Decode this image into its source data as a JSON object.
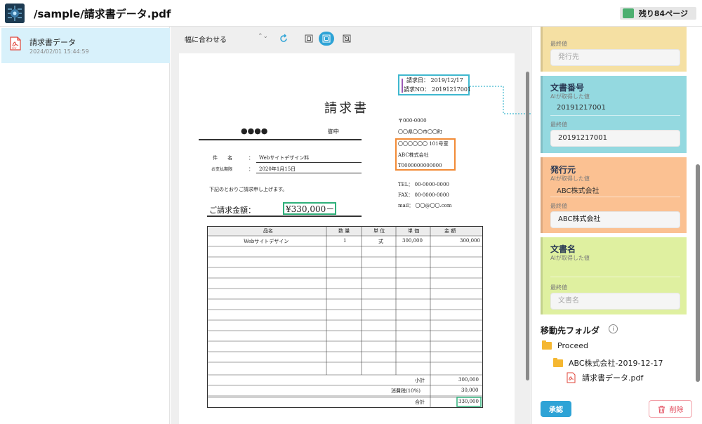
{
  "header": {
    "title": "/sample/請求書データ.pdf",
    "pages_badge": "残り84ページ",
    "badge_color": "#4caf70"
  },
  "file_list": {
    "items": [
      {
        "name": "請求書データ",
        "date": "2024/02/01 15:44:59",
        "icon": "pdf-file-icon"
      }
    ]
  },
  "viewer": {
    "fit_mode": "幅に合わせる",
    "tools": [
      "rotate-icon",
      "fit-page-icon",
      "fit-width-icon",
      "fit-none-icon"
    ]
  },
  "document": {
    "heading": "請求書",
    "invoice_date_label": "請求日：",
    "invoice_date": "2019/12/17",
    "invoice_no_label": "請求NO：",
    "invoice_no": "20191217001",
    "customer": "●●●●",
    "honorific": "御中",
    "subject_label": "件　　名",
    "subject_value": "Webサイトデザイン料",
    "due_label": "お支払期限",
    "due_value": "2020年1月15日",
    "colon": "：",
    "intro": "下記のとおりご請求申し上げます。",
    "amount_label": "ご請求金額：",
    "amount_value": "¥330,000－",
    "postal": "〒000-0000",
    "address1": "〇〇県〇〇市〇〇町",
    "address2": "〇〇〇〇〇〇 101号室",
    "company": "ABC株式会社",
    "reg_no": "T0000000000000",
    "tel": "TEL：  00-0000-0000",
    "fax": "FAX：  00-0000-0000",
    "mail": "mail：  〇〇@〇〇.com",
    "table": {
      "headers": [
        "品名",
        "数 量",
        "単 位",
        "単 価",
        "金 額"
      ],
      "rows": [
        [
          "Webサイトデザイン",
          "1",
          "式",
          "300,000",
          "300,000"
        ]
      ],
      "subtotal_label": "小計",
      "subtotal": "300,000",
      "tax_label": "消費税(10%)",
      "tax": "30,000",
      "total_label": "合計",
      "total": "330,000"
    }
  },
  "fields": {
    "publisher_top": {
      "final_label": "最終値",
      "placeholder": "発行先",
      "color": "#f5e0a3"
    },
    "doc_number": {
      "title": "文書番号",
      "ai_label": "AIが取得した値",
      "ai_value": "20191217001",
      "final_label": "最終値",
      "final_value": "20191217001",
      "color": "#94d9e0"
    },
    "issuer": {
      "title": "発行元",
      "ai_label": "AIが取得した値",
      "ai_value": "ABC株式会社",
      "final_label": "最終値",
      "final_value": "ABC株式会社",
      "color": "#fbc192"
    },
    "doc_name": {
      "title": "文書名",
      "ai_label": "AIが取得した値",
      "ai_value": "",
      "final_label": "最終値",
      "placeholder": "文書名",
      "color": "#dff0a0"
    }
  },
  "destination": {
    "title": "移動先フォルダ",
    "tree": [
      {
        "label": "Proceed",
        "type": "folder"
      },
      {
        "label": "ABC株式会社-2019-12-17",
        "type": "folder"
      },
      {
        "label": "請求書データ.pdf",
        "type": "file"
      }
    ]
  },
  "actions": {
    "approve": "承認",
    "delete": "削除"
  },
  "colors": {
    "accent": "#2ea3d6",
    "delete": "#e24b5c",
    "highlight_cyan": "#3fb8cf",
    "highlight_orange": "#f28b36",
    "highlight_green": "#2fb07a"
  }
}
